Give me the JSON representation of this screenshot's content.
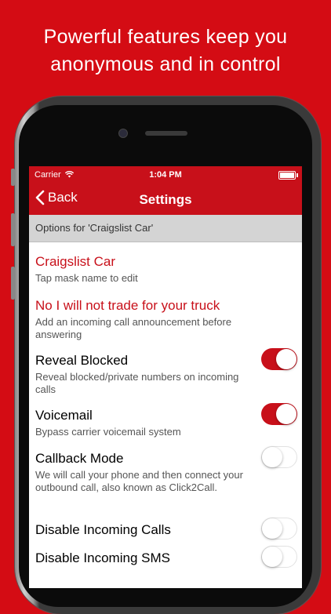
{
  "headline": {
    "line1": "Powerful features keep you",
    "line2": "anonymous and in control"
  },
  "status_bar": {
    "carrier": "Carrier",
    "time": "1:04 PM"
  },
  "nav": {
    "back_label": "Back",
    "title": "Settings"
  },
  "section": {
    "header": "Options for 'Craigslist Car'"
  },
  "mask": {
    "name": "Craigslist Car",
    "hint": "Tap mask name to edit"
  },
  "announcement": {
    "title": "No I will not trade for your truck",
    "description": "Add an incoming call announcement before answering"
  },
  "settings": [
    {
      "label": "Reveal Blocked",
      "description": "Reveal blocked/private numbers on incoming calls",
      "on": true
    },
    {
      "label": "Voicemail",
      "description": "Bypass carrier voicemail system",
      "on": true
    },
    {
      "label": "Callback Mode",
      "description": "We will call your phone and then connect your outbound call, also known as Click2Call.",
      "on": false
    },
    {
      "label": "Disable Incoming Calls",
      "description": "",
      "on": false
    },
    {
      "label": "Disable Incoming SMS",
      "description": "",
      "on": false
    }
  ],
  "colors": {
    "brand_red": "#c8101a",
    "background_red": "#d40c14"
  }
}
